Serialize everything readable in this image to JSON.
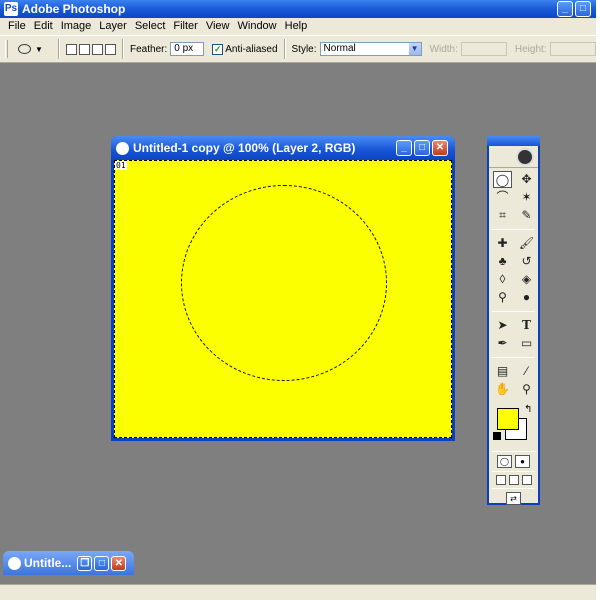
{
  "app": {
    "title": "Adobe Photoshop"
  },
  "menu": [
    "File",
    "Edit",
    "Image",
    "Layer",
    "Select",
    "Filter",
    "View",
    "Window",
    "Help"
  ],
  "options": {
    "feather_label": "Feather:",
    "feather_value": "0 px",
    "antialiased_label": "Anti-aliased",
    "antialiased_checked": true,
    "style_label": "Style:",
    "style_value": "Normal",
    "width_label": "Width:",
    "height_label": "Height:"
  },
  "document": {
    "title": "Untitled-1 copy @ 100% (Layer 2, RGB)",
    "canvas_color": "#fbff00",
    "canvas_tag": "01"
  },
  "minimized_doc": {
    "title": "Untitle..."
  },
  "toolbox": {
    "tools": [
      "elliptical-marquee",
      "move",
      "lasso",
      "magic-wand",
      "crop",
      "slice",
      "healing-brush",
      "brush",
      "clone-stamp",
      "history-brush",
      "eraser",
      "paint-bucket",
      "dodge",
      "burn",
      "path-selection",
      "type",
      "pen",
      "rectangle",
      "notes",
      "eyedropper",
      "hand",
      "zoom"
    ],
    "foreground_color": "#fbff00",
    "background_color": "#ffffff"
  }
}
